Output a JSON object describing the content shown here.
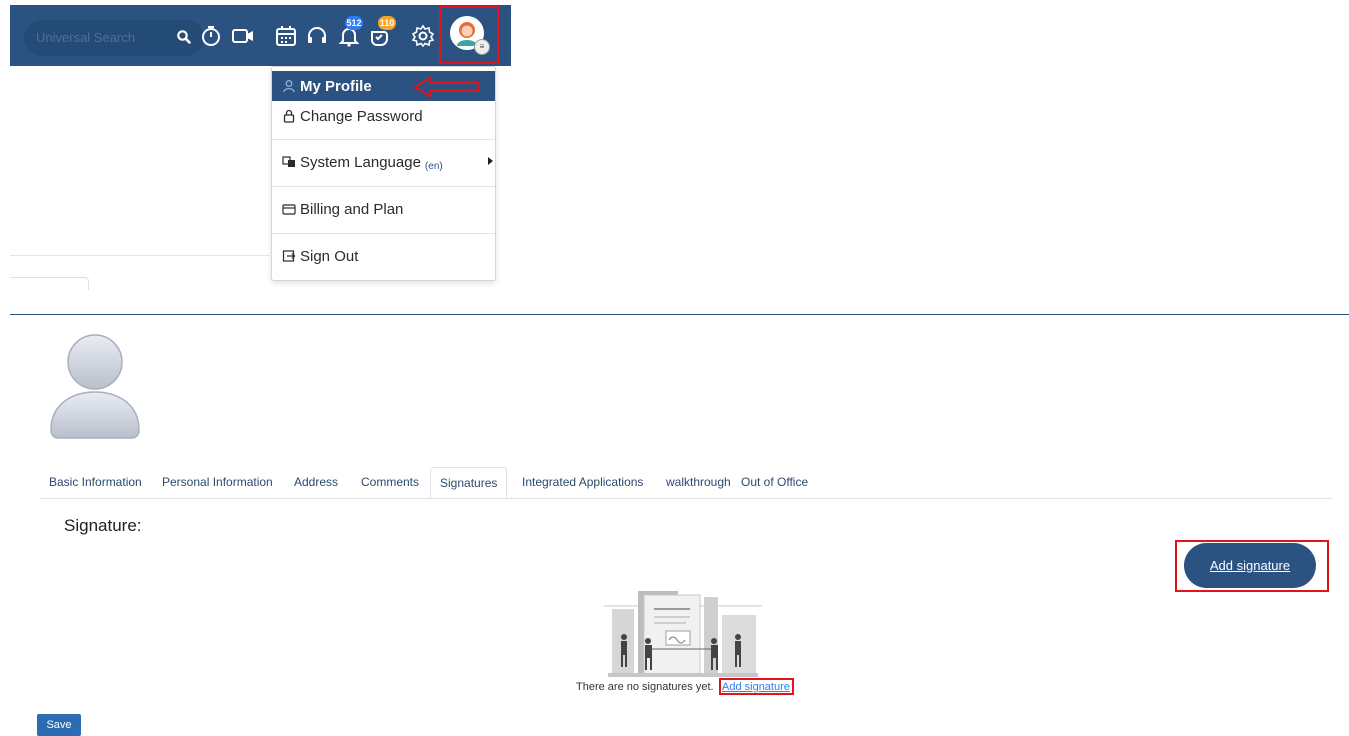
{
  "header": {
    "search_placeholder": "Universal Search",
    "notification_count": "512",
    "tasks_count": "110"
  },
  "user_menu": {
    "items": [
      {
        "label": "My Profile",
        "icon": "user-icon"
      },
      {
        "label": "Change Password",
        "icon": "lock-icon"
      },
      {
        "label": "System Language",
        "sub": "(en)",
        "icon": "language-icon"
      },
      {
        "label": "Billing and Plan",
        "icon": "card-icon"
      },
      {
        "label": "Sign Out",
        "icon": "sign-out-icon"
      }
    ]
  },
  "profile": {
    "tabs": [
      {
        "label": "Basic Information"
      },
      {
        "label": "Personal Information"
      },
      {
        "label": "Address"
      },
      {
        "label": "Comments"
      },
      {
        "label": "Signatures"
      },
      {
        "label": "Integrated Applications"
      },
      {
        "label": "walkthrough"
      },
      {
        "label": "Out of Office"
      }
    ],
    "active_tab": "Signatures",
    "signature_heading": "Signature:",
    "add_signature_button": "Add signature",
    "empty_message": "There are no signatures yet.",
    "empty_link": "Add signature",
    "save_button": "Save"
  },
  "colors": {
    "brand": "#2b5280",
    "highlight": "#e0151b",
    "link": "#2f7df0"
  }
}
